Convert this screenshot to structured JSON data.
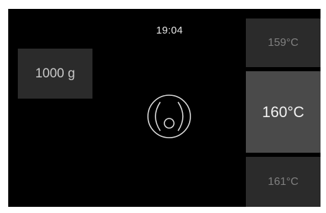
{
  "status": {
    "time": "19:04"
  },
  "weight": {
    "label": "1000 g"
  },
  "temperature": {
    "previous": "159°C",
    "current": "160°C",
    "next": "161°C"
  },
  "icons": {
    "program": "oven-program-icon"
  },
  "colors": {
    "background": "#000000",
    "tile": "#2b2b2b",
    "tile_selected": "#4a4a4a",
    "text_primary": "#f2f2f2",
    "text_muted": "#808080"
  }
}
